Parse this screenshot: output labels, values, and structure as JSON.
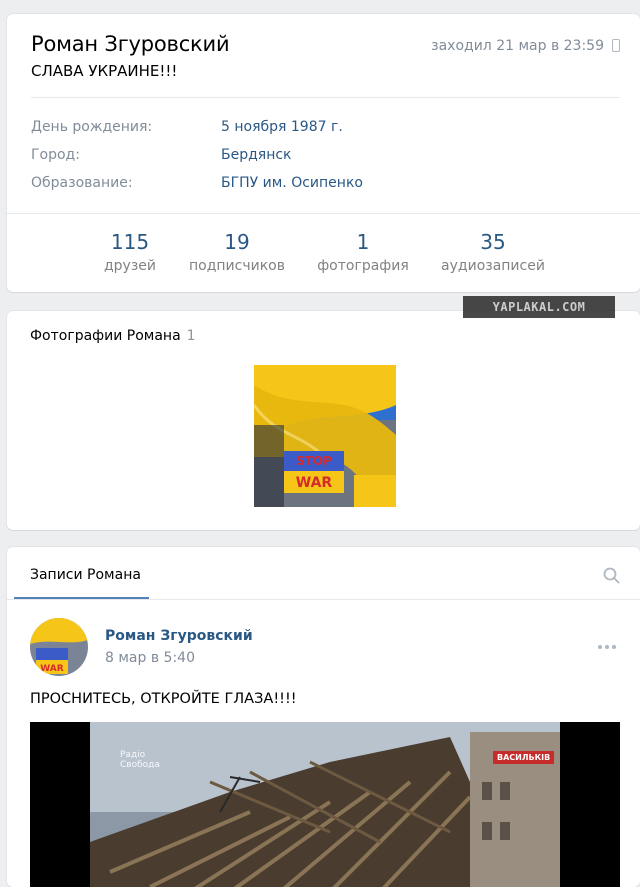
{
  "profile": {
    "name": "Роман Згуровский",
    "last_seen": "заходил 21 мар в 23:59",
    "status": "СЛАВА УКРАИНЕ!!!",
    "info": [
      {
        "label": "День рождения:",
        "value": "5 ноября 1987 г."
      },
      {
        "label": "Город:",
        "value": "Бердянск"
      },
      {
        "label": "Образование:",
        "value": "БГПУ им. Осипенко"
      }
    ],
    "counters": [
      {
        "num": "115",
        "label": "друзей"
      },
      {
        "num": "19",
        "label": "подписчиков"
      },
      {
        "num": "1",
        "label": "фотография"
      },
      {
        "num": "35",
        "label": "аудиозаписей"
      }
    ]
  },
  "photos": {
    "title": "Фотографии Романа",
    "count": "1",
    "thumb_sign_top": "STOP",
    "thumb_sign_bottom": "WAR"
  },
  "wall": {
    "tab_label": "Записи Романа",
    "post": {
      "author": "Роман Згуровский",
      "date": "8 мар в 5:40",
      "text": "ПРОСНИТЕСЬ, ОТКРОЙТЕ ГЛАЗА!!!!",
      "avatar_sign": "WAR",
      "video_logo_line1": "Радіо",
      "video_logo_line2": "Свобода",
      "video_tag": "ВАСИЛЬКІВ"
    }
  },
  "watermark": "YAPLAKAL.COM",
  "colors": {
    "background": "#edeef0",
    "link": "#2a5885",
    "muted": "#818c99",
    "accent": "#5181b8",
    "flag_blue": "#2f6fd0",
    "flag_yellow": "#f5c518"
  }
}
